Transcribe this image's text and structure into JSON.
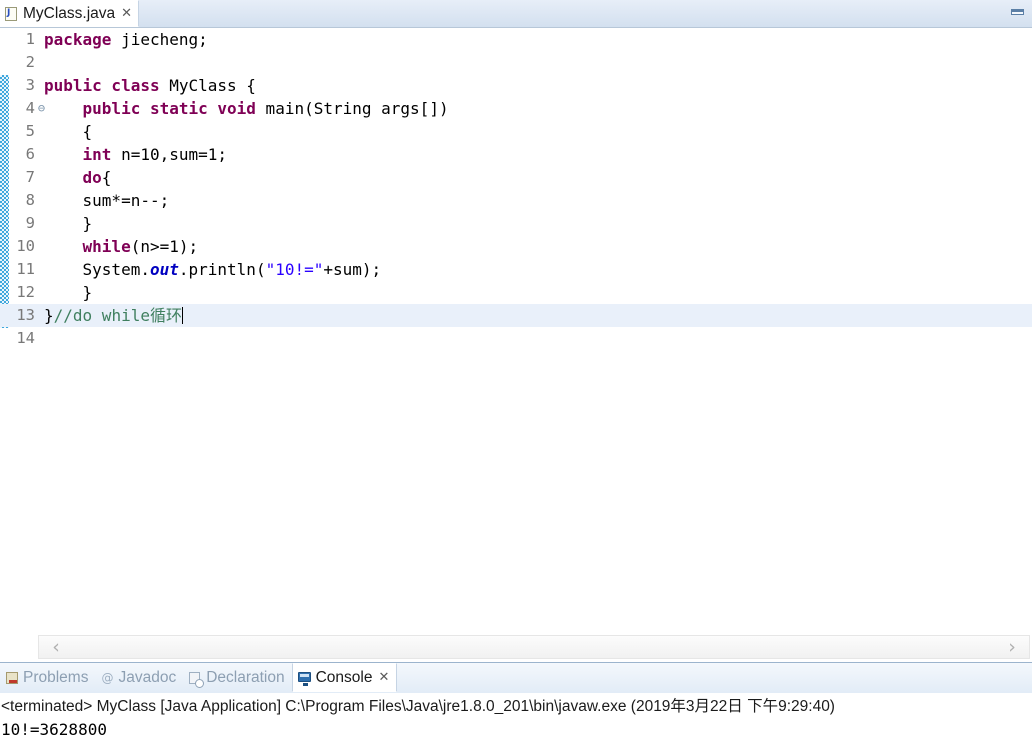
{
  "window": {
    "minimize_restore_icon": "restore-icon"
  },
  "editor": {
    "tab": {
      "icon": "java-file-icon",
      "label": "MyClass.java",
      "close": "✕"
    },
    "lines": [
      {
        "number": "1",
        "fold": "",
        "indent": 0,
        "tokens": [
          {
            "t": "package",
            "c": "kw"
          },
          {
            "t": " jiecheng;",
            "c": "plain"
          }
        ]
      },
      {
        "number": "2",
        "fold": "",
        "indent": 0,
        "tokens": []
      },
      {
        "number": "3",
        "fold": "",
        "indent": 0,
        "tokens": [
          {
            "t": "public class",
            "c": "kw"
          },
          {
            "t": " MyClass {",
            "c": "plain"
          }
        ]
      },
      {
        "number": "4",
        "fold": "⊖",
        "indent": 4,
        "tokens": [
          {
            "t": "public static void",
            "c": "kw"
          },
          {
            "t": " main(String args[])",
            "c": "plain"
          }
        ]
      },
      {
        "number": "5",
        "fold": "",
        "indent": 4,
        "tokens": [
          {
            "t": "{",
            "c": "plain"
          }
        ]
      },
      {
        "number": "6",
        "fold": "",
        "indent": 4,
        "tokens": [
          {
            "t": "int",
            "c": "kw"
          },
          {
            "t": " n=10,sum=1;",
            "c": "plain"
          }
        ]
      },
      {
        "number": "7",
        "fold": "",
        "indent": 4,
        "tokens": [
          {
            "t": "do",
            "c": "kw"
          },
          {
            "t": "{",
            "c": "plain"
          }
        ]
      },
      {
        "number": "8",
        "fold": "",
        "indent": 4,
        "tokens": [
          {
            "t": "sum*=n--;",
            "c": "plain"
          }
        ]
      },
      {
        "number": "9",
        "fold": "",
        "indent": 4,
        "tokens": [
          {
            "t": "}",
            "c": "plain"
          }
        ]
      },
      {
        "number": "10",
        "fold": "",
        "indent": 4,
        "tokens": [
          {
            "t": "while",
            "c": "kw"
          },
          {
            "t": "(n>=1);",
            "c": "plain"
          }
        ]
      },
      {
        "number": "11",
        "fold": "",
        "indent": 4,
        "tokens": [
          {
            "t": "System.",
            "c": "plain"
          },
          {
            "t": "out",
            "c": "fld"
          },
          {
            "t": ".println(",
            "c": "plain"
          },
          {
            "t": "\"10!=\"",
            "c": "str"
          },
          {
            "t": "+sum);",
            "c": "plain"
          }
        ]
      },
      {
        "number": "12",
        "fold": "",
        "indent": 4,
        "tokens": [
          {
            "t": "}",
            "c": "plain"
          }
        ]
      },
      {
        "number": "13",
        "fold": "",
        "indent": 0,
        "current": true,
        "caret": true,
        "tokens": [
          {
            "t": "}",
            "c": "plain"
          },
          {
            "t": "//do while循环",
            "c": "cmt"
          }
        ]
      },
      {
        "number": "14",
        "fold": "",
        "indent": 0,
        "tokens": []
      }
    ],
    "scrollbar": {
      "left_arrow": "‹",
      "right_arrow": "›"
    }
  },
  "bottom_panel": {
    "tabs": [
      {
        "icon": "problems-icon",
        "label": "Problems",
        "active": false,
        "close": ""
      },
      {
        "icon": "javadoc-icon",
        "label": "Javadoc",
        "active": false,
        "close": ""
      },
      {
        "icon": "declaration-icon",
        "label": "Declaration",
        "active": false,
        "close": ""
      },
      {
        "icon": "console-icon",
        "label": "Console",
        "active": true,
        "close": "✕"
      }
    ],
    "console": {
      "status_line": "<terminated> MyClass [Java Application] C:\\Program Files\\Java\\jre1.8.0_201\\bin\\javaw.exe (2019年3月22日 下午9:29:40)",
      "output": "10!=3628800"
    }
  },
  "colors": {
    "keyword": "#7f0055",
    "string": "#2a00ff",
    "field": "#0000c0",
    "comment": "#3f7f5f",
    "current_line": "#e9f0fa",
    "change_bar": "#3fa7dd"
  }
}
